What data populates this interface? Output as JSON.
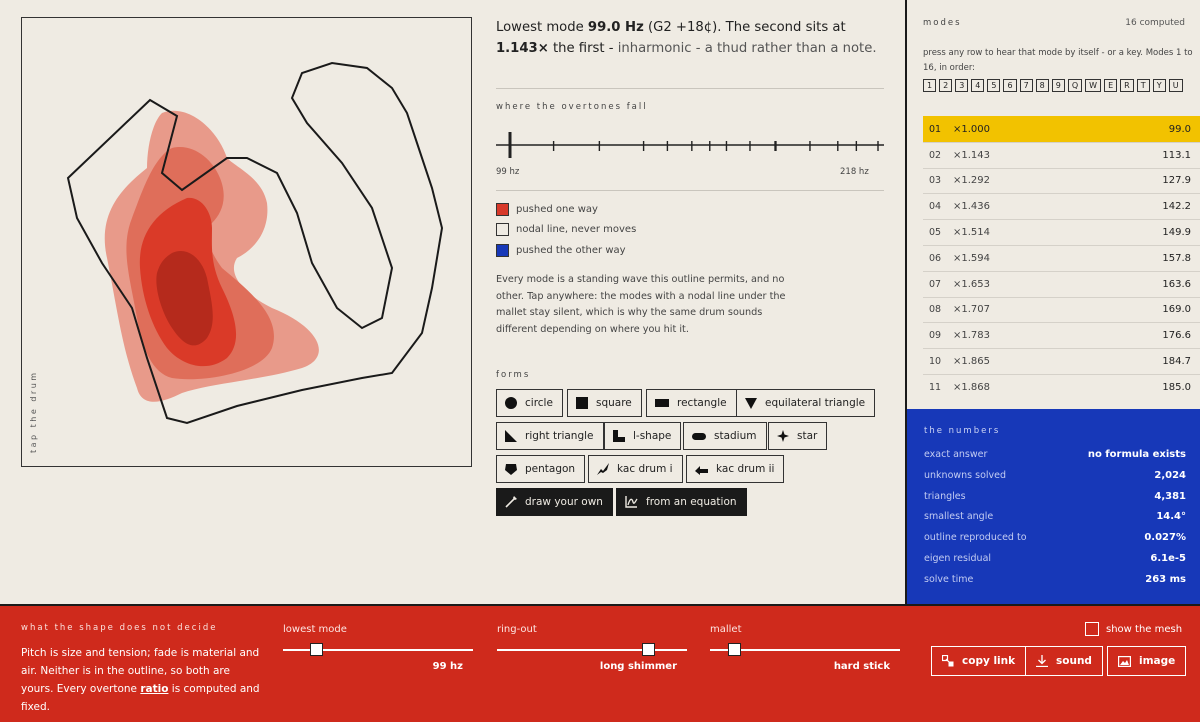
{
  "canvas": {
    "side_label": "tap the drum"
  },
  "lead": {
    "prefix": "Lowest mode ",
    "freq": "99.0 Hz",
    "note": "(G2 +18¢)",
    "mid": ". The second sits at",
    "ratio": "1.143×",
    "mid2": " the first - ",
    "verdict": "inharmonic - a thud rather than a note."
  },
  "overtones": {
    "title": "where the overtones fall",
    "lo": "99 hz",
    "hi": "218 hz"
  },
  "legend": [
    {
      "label": "pushed one way",
      "color": "#d8392a"
    },
    {
      "label": "nodal line, never moves",
      "color": "#efebe3"
    },
    {
      "label": "pushed the other way",
      "color": "#1738b8"
    }
  ],
  "description": "Every mode is a standing wave this outline permits, and no other. Tap anywhere: the modes with a nodal line under the mallet stay silent, which is why the same drum sounds different depending on where you hit it.",
  "forms": {
    "title": "forms",
    "buttons": [
      "circle",
      "square",
      "rectangle",
      "equilateral triangle",
      "right triangle",
      "l-shape",
      "stadium",
      "star",
      "pentagon",
      "kac drum i",
      "kac drum ii",
      "draw your own",
      "from an equation"
    ]
  },
  "modes": {
    "title": "modes",
    "count": "16 computed",
    "hint": "press any row to hear that mode by itself - or a key. Modes 1 to 16, in order:",
    "keys": [
      "1",
      "2",
      "3",
      "4",
      "5",
      "6",
      "7",
      "8",
      "9",
      "Q",
      "W",
      "E",
      "R",
      "T",
      "Y",
      "U"
    ],
    "rows": [
      {
        "idx": "01",
        "ratio": "×1.000",
        "hz": "99.0"
      },
      {
        "idx": "02",
        "ratio": "×1.143",
        "hz": "113.1"
      },
      {
        "idx": "03",
        "ratio": "×1.292",
        "hz": "127.9"
      },
      {
        "idx": "04",
        "ratio": "×1.436",
        "hz": "142.2"
      },
      {
        "idx": "05",
        "ratio": "×1.514",
        "hz": "149.9"
      },
      {
        "idx": "06",
        "ratio": "×1.594",
        "hz": "157.8"
      },
      {
        "idx": "07",
        "ratio": "×1.653",
        "hz": "163.6"
      },
      {
        "idx": "08",
        "ratio": "×1.707",
        "hz": "169.0"
      },
      {
        "idx": "09",
        "ratio": "×1.783",
        "hz": "176.6"
      },
      {
        "idx": "10",
        "ratio": "×1.865",
        "hz": "184.7"
      },
      {
        "idx": "11",
        "ratio": "×1.868",
        "hz": "185.0"
      }
    ]
  },
  "numbers": {
    "title": "the numbers",
    "rows": [
      {
        "k": "exact answer",
        "v": "no formula exists"
      },
      {
        "k": "unknowns solved",
        "v": "2,024"
      },
      {
        "k": "triangles",
        "v": "4,381"
      },
      {
        "k": "smallest angle",
        "v": "14.4°"
      },
      {
        "k": "outline reproduced to",
        "v": "0.027%"
      },
      {
        "k": "eigen residual",
        "v": "6.1e-5"
      },
      {
        "k": "solve time",
        "v": "263 ms"
      }
    ]
  },
  "bottom": {
    "title": "what the shape does not decide",
    "text_pre": "Pitch is size and tension; fade is material and air. Neither is in the outline, so both are yours. Every overtone ",
    "text_link": "ratio",
    "text_post": " is computed and fixed.",
    "sliders": [
      {
        "label": "lowest mode",
        "value": "99 hz",
        "level": 0.15
      },
      {
        "label": "ring-out",
        "value": "long shimmer",
        "level": 0.82
      },
      {
        "label": "mallet",
        "value": "hard stick",
        "level": 0.1
      }
    ],
    "mesh_label": "show the mesh",
    "buttons": [
      "copy link",
      "sound",
      "image"
    ]
  }
}
